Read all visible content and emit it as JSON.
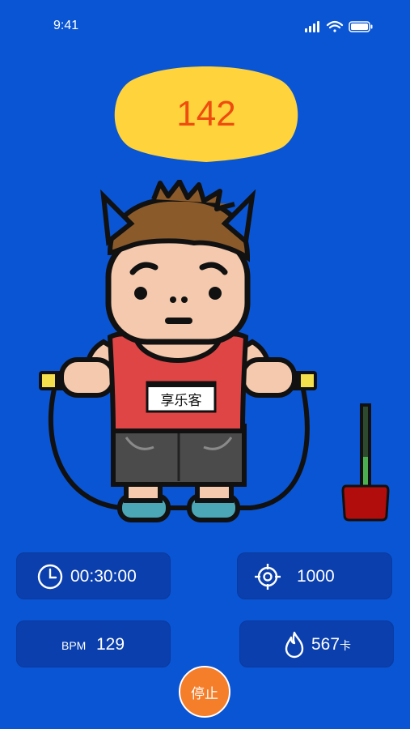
{
  "status_bar": {
    "time": "9:41"
  },
  "jump_count": "142",
  "name_tag": "享乐客",
  "stats": {
    "timer": "00:30:00",
    "target": "1000",
    "bpm_label": "BPM",
    "bpm_value": "129",
    "calories_value": "567",
    "calories_unit": "卡"
  },
  "stop_label": "停止",
  "icons": {
    "timer": "clock-icon",
    "target": "crosshair-icon",
    "calories": "flame-icon"
  },
  "colors": {
    "background": "#0a55d3",
    "card": "#0a3fad",
    "badge": "#ffd33b",
    "count_text": "#ef4c10",
    "stop_button": "#f57e2b",
    "gauge_fill": "#4caf50",
    "gauge_base": "#b10d0d"
  }
}
